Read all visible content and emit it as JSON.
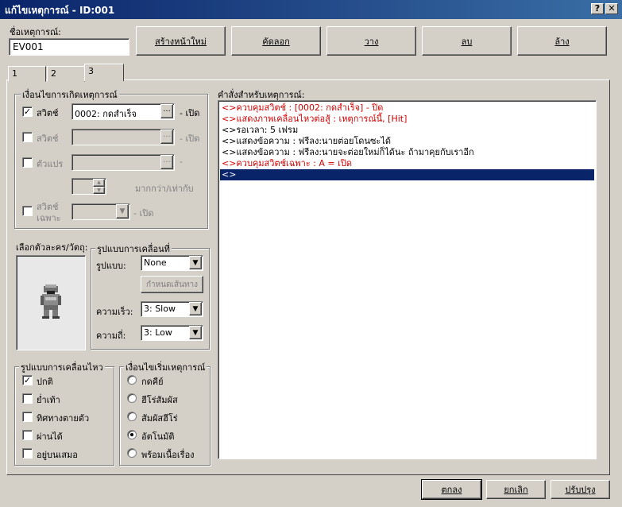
{
  "window": {
    "title": "แก้ไขเหตุการณ์ - ID:001",
    "help_glyph": "?",
    "close_glyph": "✕"
  },
  "event_name": {
    "label": "ชื่อเหตุการณ์:",
    "value": "EV001"
  },
  "toolbar": {
    "new_page": "สร้างหน้าใหม่",
    "copy": "คัดลอก",
    "paste": "วาง",
    "delete": "ลบ",
    "clear": "ล้าง"
  },
  "tabs": [
    "1",
    "2",
    "3"
  ],
  "active_tab": "3",
  "conditions": {
    "title": "เงื่อนไขการเกิดเหตุการณ์",
    "switch1": {
      "label": "สวิตช์",
      "checked": true,
      "value": "0002: กดสำเร็จ",
      "suffix": "- เปิด"
    },
    "switch2": {
      "label": "สวิตช์",
      "checked": false,
      "value": "",
      "suffix": "- เปิด"
    },
    "variable": {
      "label": "ตัวแปร",
      "checked": false,
      "value": "",
      "suffix": "-",
      "compare": "มากกว่า/เท่ากับ"
    },
    "self_switch": {
      "label_line1": "สวิตช์",
      "label_line2": "เฉพาะ",
      "checked": false,
      "suffix": "- เปิด"
    },
    "dots": "...",
    "arrow": "▼"
  },
  "graphic": {
    "label": "เลือกตัวละคร/วัตถุ:",
    "icon": "armored-knight-sprite"
  },
  "movement": {
    "title": "รูปแบบการเคลื่อนที่",
    "type_label": "รูปแบบ:",
    "type_value": "None",
    "route_button": "กำหนดเส้นทาง",
    "speed_label": "ความเร็ว:",
    "speed_value": "3: Slow",
    "freq_label": "ความถี่:",
    "freq_value": "3: Low"
  },
  "options": {
    "title": "รูปแบบการเคลื่อนไหว",
    "items": [
      {
        "label": "ปกติ",
        "checked": true
      },
      {
        "label": "ย่ำเท้า",
        "checked": false
      },
      {
        "label": "ทิศทางตายตัว",
        "checked": false
      },
      {
        "label": "ผ่านได้",
        "checked": false
      },
      {
        "label": "อยู่บนเสมอ",
        "checked": false
      }
    ]
  },
  "trigger": {
    "title": "เงื่อนไขเริ่มเหตุการณ์",
    "items": [
      {
        "label": "กดคีย์",
        "selected": false
      },
      {
        "label": "ฮีโร่สัมผัส",
        "selected": false
      },
      {
        "label": "สัมผัสฮีโร่",
        "selected": false
      },
      {
        "label": "อัตโนมัติ",
        "selected": true
      },
      {
        "label": "พร้อมเนื้อเรื่อง",
        "selected": false
      }
    ]
  },
  "commands": {
    "label": "คำสั่งสำหรับเหตุการณ์:",
    "lines": [
      {
        "text": "<>ควบคุมสวิตช์ : [0002: กดสำเร็จ] - ปิด",
        "color": "#d00000"
      },
      {
        "text": "<>แสดงภาพเคลื่อนไหวต่อสู้ : เหตุการณ์นี้, [Hit]",
        "color": "#d00000"
      },
      {
        "text": "<>รอเวลา: 5 เฟรม",
        "color": "#000000"
      },
      {
        "text": "<>แสดงข้อความ : ฟรีลง:นายต่อยโดนซะได้",
        "color": "#000000"
      },
      {
        "text": "<>แสดงข้อความ : ฟรีลง:นายจะต่อยใหม่ก็ได้นะ ถ้ามาคุยกับเราอีก",
        "color": "#000000"
      },
      {
        "text": "<>ควบคุมสวิตช์เฉพาะ : A = เปิด",
        "color": "#d00000"
      },
      {
        "text": "<>",
        "color": "#ffffff"
      }
    ],
    "selected_index": 6
  },
  "footer": {
    "ok": "ตกลง",
    "cancel": "ยกเลิก",
    "apply": "ปรับปรุง"
  }
}
